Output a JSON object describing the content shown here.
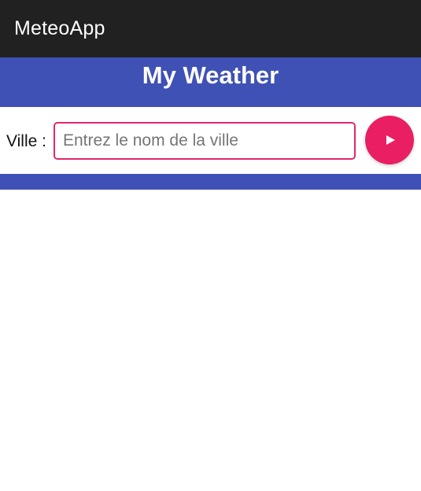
{
  "app_bar": {
    "title": "MeteoApp"
  },
  "header": {
    "title": "My Weather"
  },
  "search": {
    "label": "Ville :",
    "placeholder": "Entrez le nom de la ville",
    "value": "",
    "submit_icon": "play-arrow-icon"
  },
  "colors": {
    "app_bar": "#212121",
    "primary": "#3f51b5",
    "accent": "#e91e63",
    "input_border": "#e0276b"
  }
}
